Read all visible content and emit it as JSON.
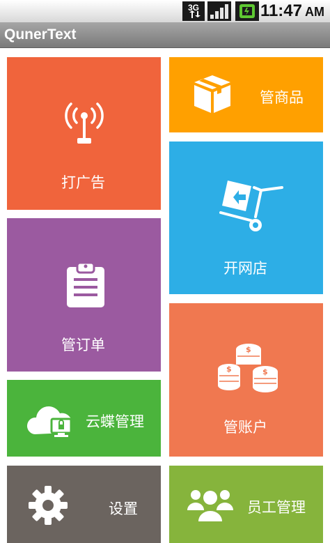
{
  "status_bar": {
    "network_label": "3G",
    "time": "11:47",
    "ampm": "AM"
  },
  "app": {
    "title": "QunerText"
  },
  "tiles": {
    "advertise": {
      "label": "打广告",
      "color": "#f0643c",
      "icon": "antenna-icon"
    },
    "products": {
      "label": "管商品",
      "color": "#ffa000",
      "icon": "package-box-icon"
    },
    "open_store": {
      "label": "开网店",
      "color": "#2daee6",
      "icon": "hand-truck-icon"
    },
    "orders": {
      "label": "管订单",
      "color": "#9b5aa0",
      "icon": "clipboard-icon"
    },
    "cloud": {
      "label": "云蝶管理",
      "color": "#4bb43c",
      "icon": "cloud-monitor-icon"
    },
    "accounts": {
      "label": "管账户",
      "color": "#f07850",
      "icon": "coins-icon"
    },
    "settings": {
      "label": "设置",
      "color": "#6b645f",
      "icon": "gear-icon"
    },
    "staff": {
      "label": "员工管理",
      "color": "#86b43c",
      "icon": "users-icon"
    }
  }
}
